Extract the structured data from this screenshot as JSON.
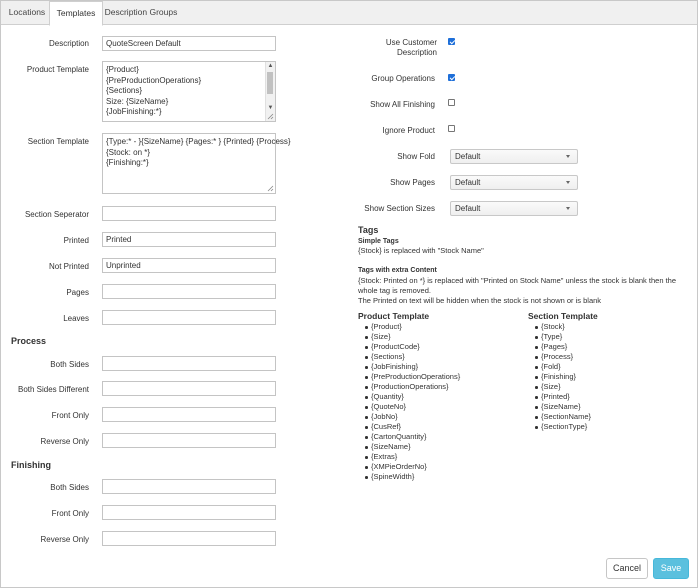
{
  "tabs": [
    {
      "label": "Locations",
      "active": false
    },
    {
      "label": "Templates",
      "active": true
    },
    {
      "label": "Description Groups",
      "active": false
    }
  ],
  "left": {
    "description": {
      "label": "Description",
      "value": "QuoteScreen Default"
    },
    "product_template": {
      "label": "Product Template",
      "lines": [
        "{Product}",
        "{PreProductionOperations}",
        "{Sections}",
        "Size: {SizeName}",
        "{JobFinishing:*}"
      ]
    },
    "section_template": {
      "label": "Section Template",
      "lines": [
        "{Type:* - }{SizeName} {Pages:* } {Printed} {Process}",
        "{Stock: on *}",
        "{Finishing:*}"
      ]
    },
    "section_seperator": {
      "label": "Section Seperator",
      "value": ""
    },
    "printed": {
      "label": "Printed",
      "value": "Printed"
    },
    "not_printed": {
      "label": "Not Printed",
      "value": "Unprinted"
    },
    "pages": {
      "label": "Pages",
      "value": ""
    },
    "leaves": {
      "label": "Leaves",
      "value": ""
    },
    "process": {
      "heading": "Process",
      "both_sides": {
        "label": "Both Sides",
        "value": ""
      },
      "both_sides_different": {
        "label": "Both Sides Different",
        "value": ""
      },
      "front_only": {
        "label": "Front Only",
        "value": ""
      },
      "reverse_only": {
        "label": "Reverse Only",
        "value": ""
      }
    },
    "finishing": {
      "heading": "Finishing",
      "both_sides": {
        "label": "Both Sides",
        "value": ""
      },
      "front_only": {
        "label": "Front Only",
        "value": ""
      },
      "reverse_only": {
        "label": "Reverse Only",
        "value": ""
      }
    }
  },
  "right": {
    "use_customer_description": {
      "label": "Use Customer Description",
      "checked": true
    },
    "group_operations": {
      "label": "Group Operations",
      "checked": true
    },
    "show_all_finishing": {
      "label": "Show All Finishing",
      "checked": false
    },
    "ignore_product": {
      "label": "Ignore Product",
      "checked": false
    },
    "show_fold": {
      "label": "Show Fold",
      "value": "Default"
    },
    "show_pages": {
      "label": "Show Pages",
      "value": "Default"
    },
    "show_section_sizes": {
      "label": "Show Section Sizes",
      "value": "Default"
    }
  },
  "tags": {
    "heading": "Tags",
    "simple_heading": "Simple Tags",
    "simple_text": "{Stock} is replaced with \"Stock Name\"",
    "extra_heading": "Tags with extra Content",
    "extra_line1": "{Stock: Printed on *} is replaced with \"Printed on Stock Name\" unless the stock is blank then the",
    "extra_line2": "whole tag is removed.",
    "extra_line3": "The Printed on text will be hidden when the stock is not shown or is blank",
    "product_heading": "Product Template",
    "product_tags": [
      "{Product}",
      "{Size}",
      "{ProductCode}",
      "{Sections}",
      "{JobFinishing}",
      "{PreProductionOperations}",
      "{ProductionOperations}",
      "{Quantity}",
      "{QuoteNo}",
      "{JobNo}",
      "{CusRef}",
      "{CartonQuantity}",
      "{SizeName}",
      "{Extras}",
      "{XMPieOrderNo}",
      "{SpineWidth}"
    ],
    "section_heading": "Section Template",
    "section_tags": [
      "{Stock}",
      "{Type}",
      "{Pages}",
      "{Process}",
      "{Fold}",
      "{Finishing}",
      "{Size}",
      "{Printed}",
      "{SizeName}",
      "{SectionName}",
      "{SectionType}"
    ]
  },
  "buttons": {
    "cancel": "Cancel",
    "save": "Save"
  }
}
